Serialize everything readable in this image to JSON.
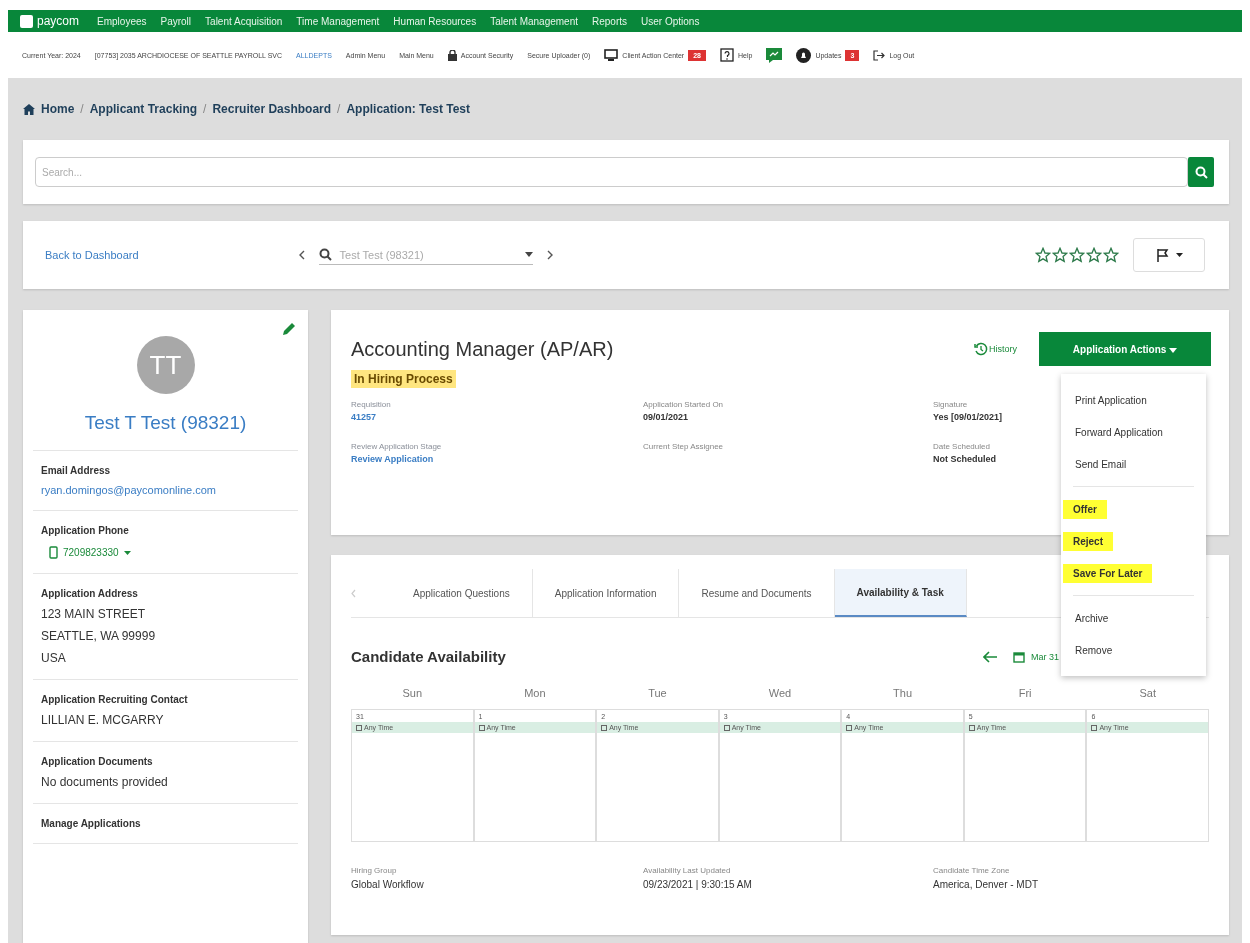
{
  "nav": {
    "logo": "paycom",
    "items": [
      "Employees",
      "Payroll",
      "Talent Acquisition",
      "Time Management",
      "Human Resources",
      "Talent Management",
      "Reports",
      "User Options"
    ]
  },
  "subbar": {
    "year": "Current Year: 2024",
    "company": "[07753] 2035 ARCHDIOCESE OF SEATTLE PAYROLL SVC",
    "dept": "ALLDEPTS",
    "links": [
      {
        "label": "Admin Menu",
        "kind": "text"
      },
      {
        "label": "Main Menu",
        "kind": "text"
      },
      {
        "label": "Account Security",
        "kind": "lock"
      },
      {
        "label": "Secure Uploader (0)",
        "kind": "text"
      },
      {
        "label": "Client Action Center",
        "kind": "monitor",
        "badge": "28"
      },
      {
        "label": "Help",
        "kind": "help"
      },
      {
        "kind": "chat"
      },
      {
        "label": "Updates",
        "kind": "bell",
        "badge": "3"
      },
      {
        "label": "Log Out",
        "kind": "logout"
      }
    ]
  },
  "breadcrumb": {
    "separator": "/",
    "items": [
      "Home",
      "Applicant Tracking",
      "Recruiter Dashboard",
      "Application: Test Test"
    ]
  },
  "search": {
    "placeholder": "Search..."
  },
  "toolbar": {
    "back": "Back to Dashboard",
    "applicant": "Test Test (98321)",
    "stars": 0
  },
  "profile": {
    "initials": "TT",
    "name": "Test T Test (98321)",
    "sections": [
      {
        "label": "Email Address",
        "lines": [
          "ryan.domingos@paycomonline.com"
        ],
        "kind": "link"
      },
      {
        "label": "Application Phone",
        "lines": [
          "7209823330"
        ],
        "kind": "phone"
      },
      {
        "label": "Application Address",
        "lines": [
          "123 MAIN STREET",
          "SEATTLE, WA 99999",
          "USA"
        ],
        "kind": "text"
      },
      {
        "label": "Application Recruiting Contact",
        "lines": [
          "LILLIAN E. MCGARRY"
        ],
        "kind": "text"
      },
      {
        "label": "Application Documents",
        "lines": [
          "No documents provided"
        ],
        "kind": "text"
      },
      {
        "label": "Manage Applications",
        "kind": "text"
      }
    ]
  },
  "application": {
    "title": "Accounting Manager (AP/AR)",
    "status": "In Hiring Process",
    "history": "History",
    "actions": "Application Actions",
    "fields": [
      {
        "label": "Requisition",
        "value": "41257",
        "link": true
      },
      {
        "label": "Application Started On",
        "value": "09/01/2021",
        "link": false
      },
      {
        "label": "Signature",
        "value": "Yes [09/01/2021]",
        "link": false
      },
      {
        "label": "Review Application Stage",
        "value": "Review Application",
        "link": true
      },
      {
        "label": "Current Step Assignee",
        "link": false
      },
      {
        "label": "Date Scheduled",
        "value": "Not Scheduled",
        "link": false
      }
    ]
  },
  "menu": {
    "groups": [
      [
        {
          "label": "Print Application",
          "highlighted": false
        },
        {
          "label": "Forward Application",
          "highlighted": false
        },
        {
          "label": "Send Email",
          "highlighted": false
        }
      ],
      [
        {
          "label": "Offer",
          "highlighted": true
        },
        {
          "label": "Reject",
          "highlighted": true
        },
        {
          "label": "Save For Later",
          "highlighted": true
        }
      ],
      [
        {
          "label": "Archive",
          "highlighted": false
        },
        {
          "label": "Remove",
          "highlighted": false
        }
      ]
    ]
  },
  "tabs": [
    {
      "label": "Application Questions",
      "selected": false
    },
    {
      "label": "Application Information",
      "selected": false
    },
    {
      "label": "Resume and Documents",
      "selected": false
    },
    {
      "label": "Availability & Task",
      "selected": true
    }
  ],
  "availability": {
    "title": "Candidate Availability",
    "date": "Mar 31",
    "days": [
      {
        "name": "Sun",
        "date": "31",
        "entry": "Any Time"
      },
      {
        "name": "Mon",
        "date": "1",
        "entry": "Any Time"
      },
      {
        "name": "Tue",
        "date": "2",
        "entry": "Any Time"
      },
      {
        "name": "Wed",
        "date": "3",
        "entry": "Any Time"
      },
      {
        "name": "Thu",
        "date": "4",
        "entry": "Any Time"
      },
      {
        "name": "Fri",
        "date": "5",
        "entry": "Any Time"
      },
      {
        "name": "Sat",
        "date": "6",
        "entry": "Any Time"
      }
    ],
    "footer": [
      {
        "label": "Hiring Group",
        "value": "Global Workflow"
      },
      {
        "label": "Availability Last Updated",
        "value": "09/23/2021 | 9:30:15 AM"
      },
      {
        "label": "Candidate Time Zone",
        "value": "America, Denver - MDT"
      }
    ]
  }
}
